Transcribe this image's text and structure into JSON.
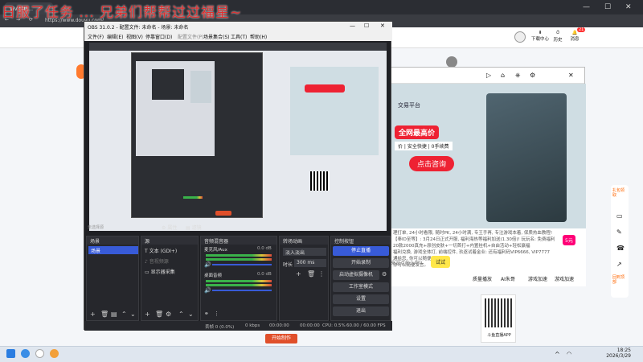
{
  "marquee": "日服了任务 ... 兄弟们帮帮过过福星~",
  "browser": {
    "tab_label": "ViVi手机... ",
    "address": "https://www.douyu.com/...",
    "window_controls": [
      "minimize-icon",
      "maximize-icon",
      "close-icon"
    ]
  },
  "douyu": {
    "download_label": "下载中心",
    "history_label": "历史",
    "message_label": "消息",
    "message_badge": "21"
  },
  "obs": {
    "title": "OBS 31.0.2 - 配置文件: 未命名 - 场景: 未命名",
    "menu": [
      "文件(F)",
      "编辑(E)",
      "视图(V)",
      "停靠窗口(D)",
      "配置文件(P)",
      "场景集合(S)",
      "工具(T)",
      "帮助(H)"
    ],
    "source_none": "未选择源",
    "props_label": "属性",
    "filters_label": "滤镜",
    "scenes": {
      "title": "场景",
      "items": [
        "场景"
      ]
    },
    "sources": {
      "title": "源",
      "items": [
        "文本 (GDI+)",
        "音视频源",
        "显示器采集"
      ]
    },
    "mixer": {
      "title": "音频混音器",
      "channels": [
        {
          "name": "麦克风/Aux",
          "db": "0.0 dB"
        },
        {
          "name": "桌面音频",
          "db": "0.0 dB"
        }
      ]
    },
    "transitions": {
      "title": "转场动画",
      "mode": "淡入淡出",
      "duration_label": "时长",
      "duration": "300 ms"
    },
    "controls": {
      "title": "控制按钮",
      "buttons": [
        "停止直播",
        "开始录制",
        "启动虚拟摄像机",
        "工作室模式",
        "设置",
        "退出"
      ]
    },
    "status": {
      "dropped": "丢帧 0 (0.0%)",
      "kbps": "0 kbps",
      "rec": "00:00:00",
      "stream": "00:00:00",
      "cpu": "CPU: 0.5%",
      "fps": "60.00 / 60.00 FPS"
    },
    "start_btn": "开始制作"
  },
  "stream": {
    "banner_title": "交易平台",
    "banner_sub": "全网最高价",
    "banner_tags": "价 | 安全快捷 | 0手续费",
    "banner_cta": "点击咨询",
    "chat": [
      "理打单, 24小时看限, 随时PK, 24小时满, 专王手再, 专注游戏本着, 保质热血教程!",
      "【奉ID至等】: 3月24日正式开服, 福利海热等福利加送(1.30倍)! 玩玩名: 免费福利",
      "20款2000真充+原创皮肤+一切首打+内置挂机+自由活动+轻松赢福",
      "福利兑换, 游戏全体打, 前端控件, 玖逐试着金业: 还有福利码VIP6666, VIP7777",
      "通给您, 你可以随便发言。",
      "你可以随便发言。"
    ],
    "chat_input": "来说点什么吧?",
    "try_label": "试试",
    "price_badge": "5元",
    "bottom_items": [
      "质量播放",
      "AI朱哥",
      "游戏加速",
      "游戏加速"
    ]
  },
  "qr": {
    "label": "斗鱼直播APP"
  },
  "side": {
    "items": [
      "礼包领取",
      "手机看",
      "反馈",
      "客服",
      "分享",
      "回到顶部"
    ]
  },
  "taskbar": {
    "time": "18:25",
    "date": "2026/3/29"
  }
}
